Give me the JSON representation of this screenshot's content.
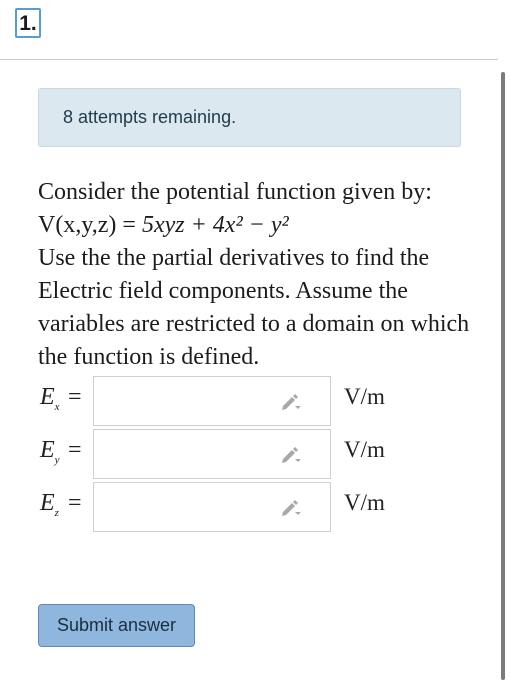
{
  "question": {
    "number": "1."
  },
  "alert": {
    "text": "8 attempts remaining."
  },
  "prompt": {
    "line1": "Consider the potential function given by:",
    "line2_prefix": "V(x,y,z) = ",
    "line2_math": "5xyz + 4x² − y²",
    "line3": "Use the the partial derivatives to find the Electric field components. Assume the variables are restricted to a domain on which the function is defined."
  },
  "fields": [
    {
      "label": "E",
      "sub": "x",
      "equals": "=",
      "unit": "V/m",
      "value": ""
    },
    {
      "label": "E",
      "sub": "y",
      "equals": "=",
      "unit": "V/m",
      "value": ""
    },
    {
      "label": "E",
      "sub": "z",
      "equals": "=",
      "unit": "V/m",
      "value": ""
    }
  ],
  "actions": {
    "submit_label": "Submit answer"
  },
  "icons": [
    "pencil-dropdown-icon"
  ]
}
